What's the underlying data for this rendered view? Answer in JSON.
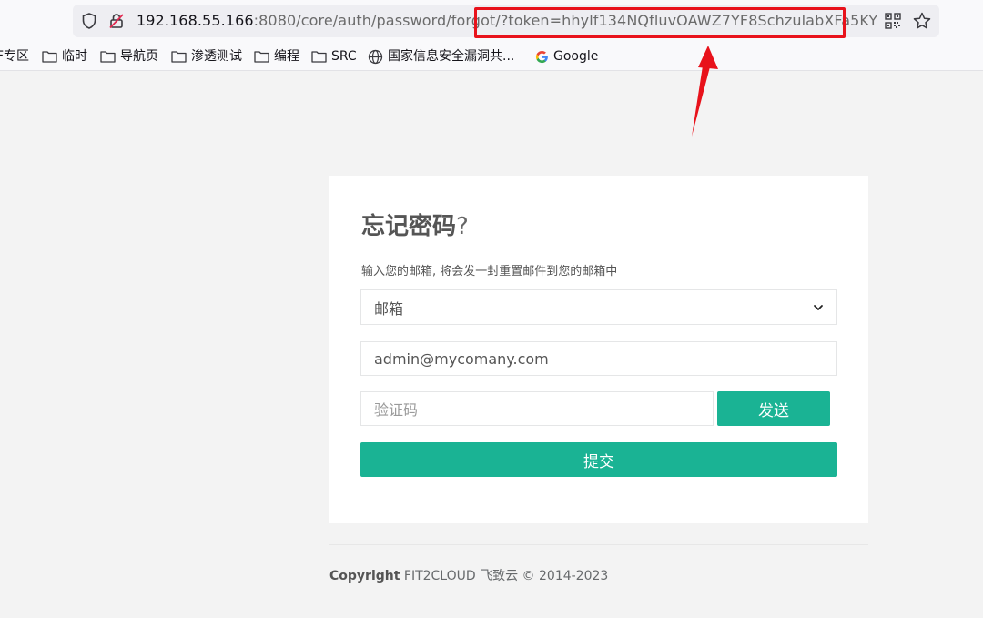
{
  "browser": {
    "url_host": "192.168.55.166",
    "url_path": ":8080/core/auth/password/forgot/",
    "url_query": "?token=hhylf134NQfluvOAWZ7YF8SchzulabXFa5KY",
    "bookmarks": [
      {
        "label": "F专区",
        "icon": "none"
      },
      {
        "label": "临时",
        "icon": "folder-icon"
      },
      {
        "label": "导航页",
        "icon": "folder-icon"
      },
      {
        "label": "渗透测试",
        "icon": "folder-icon"
      },
      {
        "label": "编程",
        "icon": "folder-icon"
      },
      {
        "label": "SRC",
        "icon": "folder-icon"
      },
      {
        "label": "国家信息安全漏洞共...",
        "icon": "globe-icon"
      },
      {
        "label": "Google",
        "icon": "google-g-icon"
      }
    ]
  },
  "annotation": {
    "color": "#e8121b"
  },
  "form": {
    "title": "忘记密码",
    "title_suffix": "?",
    "subtitle": "输入您的邮箱, 将会发一封重置邮件到您的邮箱中",
    "method_select_value": "邮箱",
    "email_value": "admin@mycomany.com",
    "code_placeholder": "验证码",
    "send_label": "发送",
    "submit_label": "提交"
  },
  "footer": {
    "copyright_label": "Copyright",
    "company": "FIT2CLOUD 飞致云 © 2014-2023"
  },
  "colors": {
    "accent": "#1ab394",
    "background": "#f3f3f3"
  }
}
